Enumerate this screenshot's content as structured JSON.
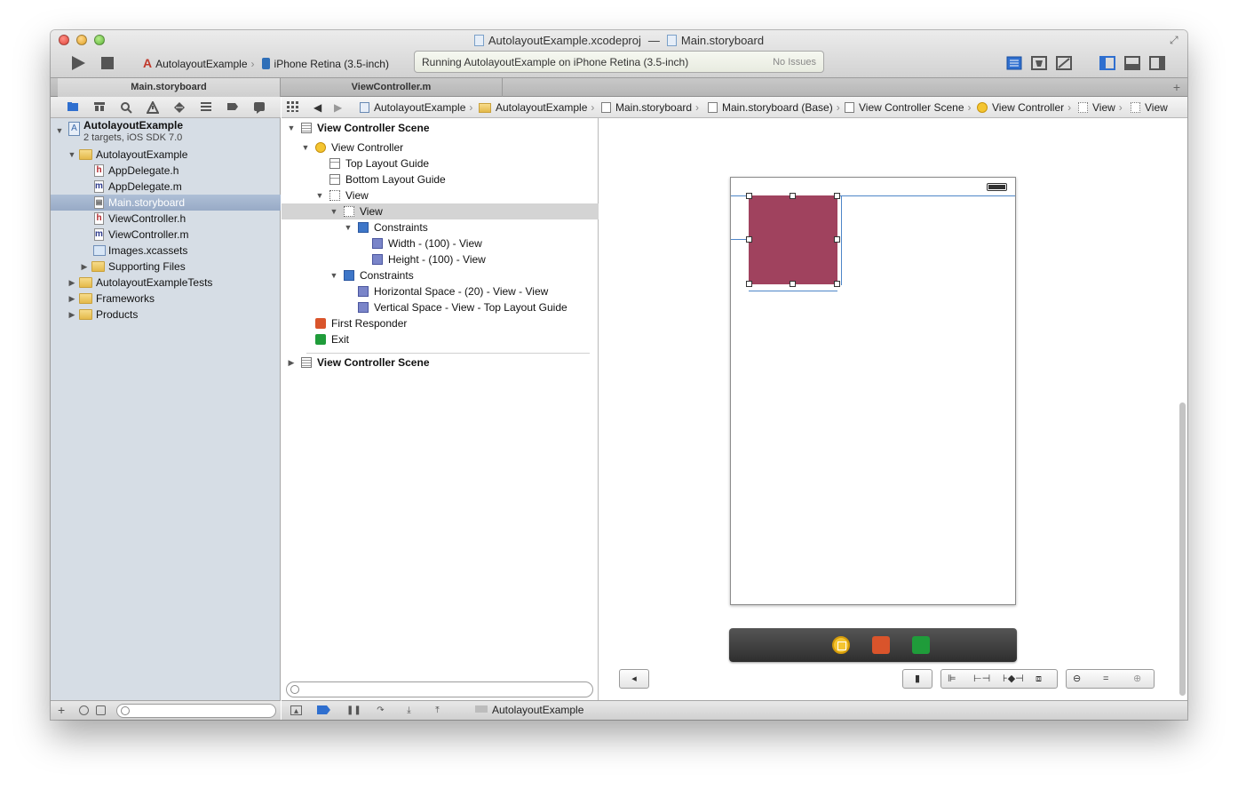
{
  "window": {
    "title_project": "AutolayoutExample.xcodeproj",
    "title_separator": "—",
    "title_file": "Main.storyboard"
  },
  "toolbar": {
    "scheme": "AutolayoutExample",
    "device": "iPhone Retina (3.5-inch)",
    "activity_message": "Running AutolayoutExample on iPhone Retina (3.5-inch)",
    "activity_issues": "No Issues"
  },
  "tabs": [
    {
      "label": "Main.storyboard"
    },
    {
      "label": "ViewController.m"
    }
  ],
  "navigator": {
    "project": {
      "name": "AutolayoutExample",
      "subtitle": "2 targets, iOS SDK 7.0"
    },
    "items": [
      {
        "label": "AutolayoutExample",
        "type": "folder"
      },
      {
        "label": "AppDelegate.h",
        "type": "h"
      },
      {
        "label": "AppDelegate.m",
        "type": "m"
      },
      {
        "label": "Main.storyboard",
        "type": "storyboard",
        "selected": true
      },
      {
        "label": "ViewController.h",
        "type": "h"
      },
      {
        "label": "ViewController.m",
        "type": "m"
      },
      {
        "label": "Images.xcassets",
        "type": "assets"
      },
      {
        "label": "Supporting Files",
        "type": "folder"
      },
      {
        "label": "AutolayoutExampleTests",
        "type": "folder"
      },
      {
        "label": "Frameworks",
        "type": "folder"
      },
      {
        "label": "Products",
        "type": "folder"
      }
    ],
    "file_type_letters": {
      "h": "h",
      "m": "m"
    }
  },
  "jumpbar": {
    "crumbs": [
      "AutolayoutExample",
      "AutolayoutExample",
      "Main.storyboard",
      "Main.storyboard (Base)",
      "View Controller Scene",
      "View Controller",
      "View",
      "View"
    ]
  },
  "outline": {
    "rows": [
      "View Controller Scene",
      "View Controller",
      "Top Layout Guide",
      "Bottom Layout Guide",
      "View",
      "View",
      "Constraints",
      "Width - (100) - View",
      "Height - (100) - View",
      "Constraints",
      "Horizontal Space - (20) - View - View",
      "Vertical Space - View - Top Layout Guide",
      "First Responder",
      "Exit",
      "View Controller Scene"
    ]
  },
  "canvas": {
    "view_color": "#a0425e",
    "accent_guides": "#4e86c8"
  },
  "debug": {
    "target": "AutolayoutExample"
  }
}
